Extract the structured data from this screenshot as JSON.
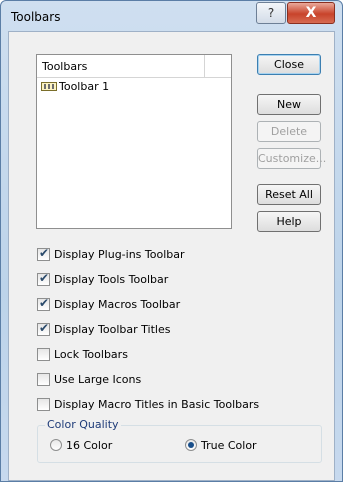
{
  "window": {
    "title": "Toolbars"
  },
  "titlebar_buttons": {
    "help": "?",
    "close": "X"
  },
  "toolbars_list": {
    "header": "Toolbars",
    "items": [
      {
        "label": "Toolbar 1",
        "icon": "toolbar-icon"
      }
    ]
  },
  "buttons": {
    "close": "Close",
    "new": "New",
    "delete": "Delete",
    "customize": "Customize...",
    "reset_all": "Reset All",
    "help": "Help"
  },
  "checkboxes": [
    {
      "label": "Display Plug-ins Toolbar",
      "checked": true
    },
    {
      "label": "Display Tools Toolbar",
      "checked": true
    },
    {
      "label": "Display Macros Toolbar",
      "checked": true
    },
    {
      "label": "Display Toolbar Titles",
      "checked": true
    },
    {
      "label": "Lock Toolbars",
      "checked": false
    },
    {
      "label": "Use Large Icons",
      "checked": false
    },
    {
      "label": "Display Macro Titles in Basic Toolbars",
      "checked": false
    }
  ],
  "color_quality": {
    "legend": "Color Quality",
    "options": [
      {
        "label": "16 Color",
        "selected": false
      },
      {
        "label": "True Color",
        "selected": true
      }
    ]
  },
  "colors": {
    "title_bar": "#c7d9ee",
    "dialog_bg": "#f0f0f0",
    "close_red": "#c8432b",
    "accent_blue": "#3c7fb1"
  }
}
